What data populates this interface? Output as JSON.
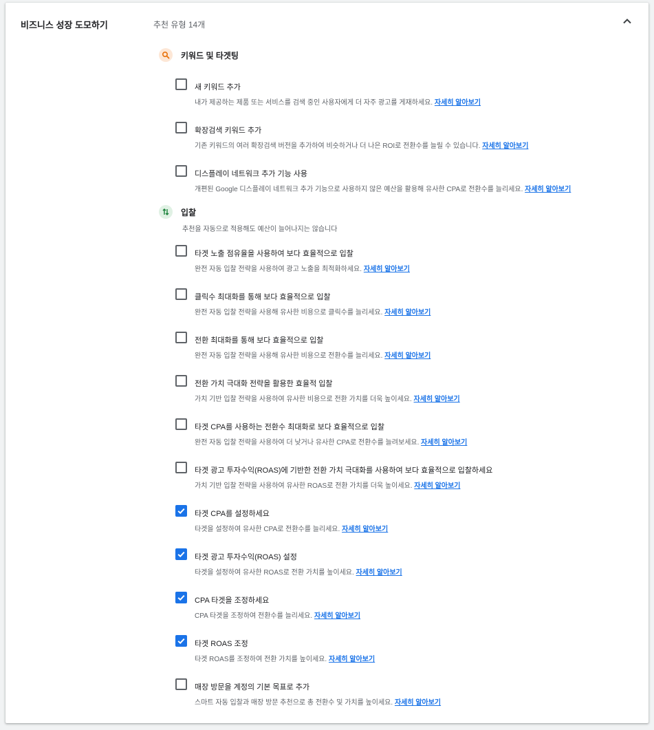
{
  "section": {
    "title": "비즈니스 성장 도모하기",
    "summary": "추천 유형 14개"
  },
  "colors": {
    "accent": "#1a73e8",
    "search_icon_bg": "#fde7d6",
    "bid_icon_bg": "#e0f1e4"
  },
  "groups": [
    {
      "title": "키워드 및 타겟팅",
      "icon": "search-icon",
      "items": [
        {
          "title": "새 키워드 추가",
          "desc": "내가 제공하는 제품 또는 서비스를 검색 중인 사용자에게 더 자주 광고를 게재하세요.",
          "link": "자세히 알아보기",
          "checked": false
        },
        {
          "title": "확장검색 키워드 추가",
          "desc": "기존 키워드의 여러 확장검색 버전을 추가하여 비슷하거나 더 나은 ROI로 전환수를 늘릴 수 있습니다.",
          "link": "자세히 알아보기",
          "checked": false
        },
        {
          "title": "디스플레이 네트워크 추가 기능 사용",
          "desc": "개편된 Google 디스플레이 네트워크 추가 기능으로 사용하지 않은 예산을 활용해 유사한 CPA로 전환수를 늘리세요.",
          "link": "자세히 알아보기",
          "checked": false
        }
      ]
    },
    {
      "title": "입찰",
      "icon": "bidding-arrows-icon",
      "note": "추천을 자동으로 적용해도 예산이 늘어나지는 않습니다",
      "items": [
        {
          "title": "타겟 노출 점유율을 사용하여 보다 효율적으로 입찰",
          "desc": "완전 자동 입찰 전략을 사용하여 광고 노출을 최적화하세요.",
          "link": "자세히 알아보기",
          "checked": false
        },
        {
          "title": "클릭수 최대화를 통해 보다 효율적으로 입찰",
          "desc": "완전 자동 입찰 전략을 사용해 유사한 비용으로 클릭수를 늘리세요.",
          "link": "자세히 알아보기",
          "checked": false
        },
        {
          "title": "전환 최대화를 통해 보다 효율적으로 입찰",
          "desc": "완전 자동 입찰 전략을 사용해 유사한 비용으로 전환수를 늘리세요.",
          "link": "자세히 알아보기",
          "checked": false
        },
        {
          "title": "전환 가치 극대화 전략을 활용한 효율적 입찰",
          "desc": "가치 기반 입찰 전략을 사용하여 유사한 비용으로 전환 가치를 더욱 높이세요.",
          "link": "자세히 알아보기",
          "checked": false
        },
        {
          "title": "타겟 CPA를 사용하는 전환수 최대화로 보다 효율적으로 입찰",
          "desc": "완전 자동 입찰 전략을 사용하여 더 낮거나 유사한 CPA로 전환수를 늘려보세요.",
          "link": "자세히 알아보기",
          "checked": false
        },
        {
          "title": "타겟 광고 투자수익(ROAS)에 기반한 전환 가치 극대화를 사용하여 보다 효율적으로 입찰하세요",
          "desc": "가치 기반 입찰 전략을 사용하여 유사한 ROAS로 전환 가치를 더욱 높이세요.",
          "link": "자세히 알아보기",
          "checked": false
        },
        {
          "title": "타겟 CPA를 설정하세요",
          "desc": "타겟을 설정하여 유사한 CPA로 전환수를 늘리세요.",
          "link": "자세히 알아보기",
          "checked": true
        },
        {
          "title": "타겟 광고 투자수익(ROAS) 설정",
          "desc": "타겟을 설정하여 유사한 ROAS로 전환 가치를 높이세요.",
          "link": "자세히 알아보기",
          "checked": true
        },
        {
          "title": "CPA 타겟을 조정하세요",
          "desc": "CPA 타겟을 조정하여 전환수를 늘리세요.",
          "link": "자세히 알아보기",
          "checked": true
        },
        {
          "title": "타겟 ROAS 조정",
          "desc": "타겟 ROAS를 조정하여 전환 가치를 높이세요.",
          "link": "자세히 알아보기",
          "checked": true
        },
        {
          "title": "매장 방문을 계정의 기본 목표로 추가",
          "desc": "스마트 자동 입찰과 매장 방문 추천으로 총 전환수 및 가치를 높이세요.",
          "link": "자세히 알아보기",
          "checked": false
        }
      ]
    }
  ]
}
